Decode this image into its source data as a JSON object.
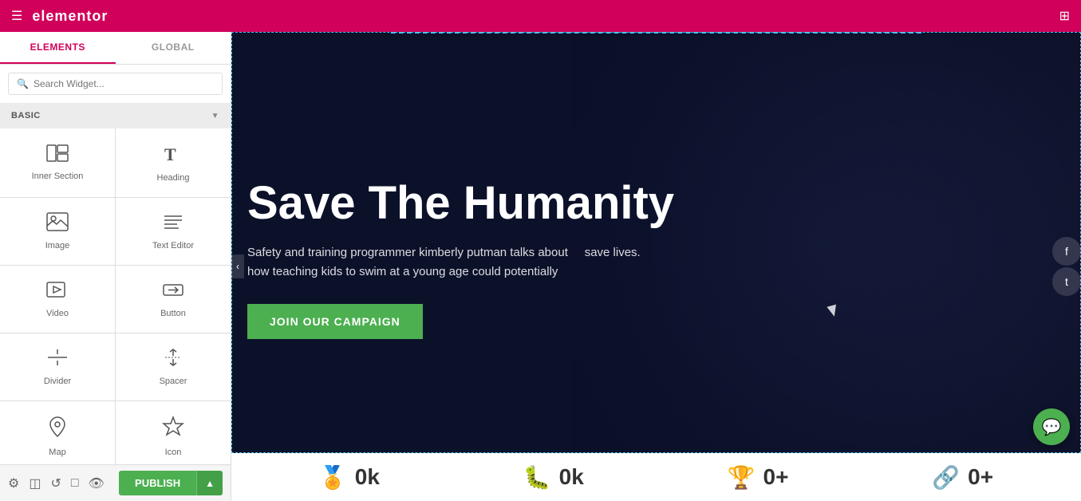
{
  "topbar": {
    "logo": "elementor",
    "hamburger_label": "☰",
    "grid_label": "⊞"
  },
  "sidebar": {
    "tabs": [
      {
        "id": "elements",
        "label": "ELEMENTS",
        "active": true
      },
      {
        "id": "global",
        "label": "GLOBAL",
        "active": false
      }
    ],
    "search_placeholder": "Search Widget...",
    "section_label": "BASIC",
    "widgets": [
      {
        "id": "inner-section",
        "label": "Inner Section",
        "icon": "▦"
      },
      {
        "id": "heading",
        "label": "Heading",
        "icon": "T"
      },
      {
        "id": "image",
        "label": "Image",
        "icon": "🖼"
      },
      {
        "id": "text-editor",
        "label": "Text Editor",
        "icon": "≡"
      },
      {
        "id": "video",
        "label": "Video",
        "icon": "▶"
      },
      {
        "id": "button",
        "label": "Button",
        "icon": "⬡"
      },
      {
        "id": "divider",
        "label": "Divider",
        "icon": "÷"
      },
      {
        "id": "spacer",
        "label": "Spacer",
        "icon": "↕"
      },
      {
        "id": "map",
        "label": "Map",
        "icon": "📍"
      },
      {
        "id": "icon",
        "label": "Icon",
        "icon": "★"
      }
    ]
  },
  "toolbar_bottom": {
    "icons": [
      "⊙",
      "◫",
      "↺",
      "□",
      "👁"
    ],
    "publish_label": "PUBLISH",
    "publish_arrow": "▲"
  },
  "canvas": {
    "hero_title": "Save The Humanity",
    "hero_subtitle": "Safety and training programmer kimberly putman talks about     save lives.\nhow teaching kids to swim at a young age could potentially",
    "campaign_btn": "JOIN OUR CAMPAIGN",
    "stats": [
      {
        "icon": "🏅",
        "value": "0k"
      },
      {
        "icon": "🐛",
        "value": "0k"
      },
      {
        "icon": "🏆",
        "value": "0+"
      },
      {
        "icon": "🔗",
        "value": "0+"
      }
    ]
  },
  "social": {
    "facebook": "f",
    "twitter": "t"
  },
  "chat_icon": "💬"
}
